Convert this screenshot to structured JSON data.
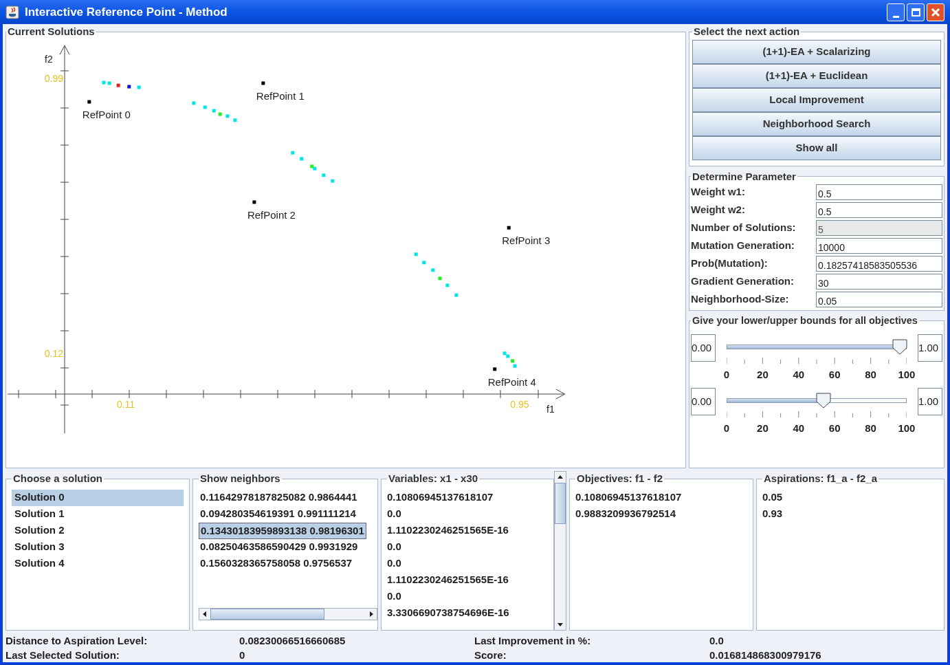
{
  "window": {
    "title": "Interactive Reference Point - Method"
  },
  "plot": {
    "title": "Current Solutions",
    "chart_data": {
      "type": "scatter",
      "xlabel": "f1",
      "ylabel": "f2",
      "xlim": [
        -0.142,
        1.045
      ],
      "ylim": [
        -0.133,
        1.093
      ],
      "xticks": [
        {
          "value": 0.11,
          "label": "0.11"
        },
        {
          "value": 0.95,
          "label": "0.95"
        }
      ],
      "yticks": [
        {
          "value": 0.99,
          "label": "0.99"
        },
        {
          "value": 0.12,
          "label": "0.12"
        }
      ],
      "series": [
        {
          "color": "#00e5e5",
          "x": [
            0.063,
            0.075,
            0.138,
            0.255,
            0.279,
            0.298,
            0.327,
            0.343,
            0.466,
            0.485,
            0.513,
            0.532,
            0.551,
            0.729,
            0.746,
            0.765,
            0.796,
            0.815,
            0.918,
            0.925,
            0.94
          ],
          "values": [
            0.976,
            0.974,
            0.961,
            0.911,
            0.898,
            0.887,
            0.87,
            0.857,
            0.754,
            0.735,
            0.704,
            0.683,
            0.665,
            0.433,
            0.407,
            0.383,
            0.335,
            0.304,
            0.12,
            0.111,
            0.08
          ]
        },
        {
          "color": "#22ee22",
          "x": [
            0.311,
            0.507,
            0.78,
            0.935
          ],
          "values": [
            0.876,
            0.711,
            0.357,
            0.096
          ]
        },
        {
          "color": "#e02020",
          "x": [
            0.094
          ],
          "values": [
            0.967
          ]
        },
        {
          "color": "#1010d0",
          "x": [
            0.117
          ],
          "values": [
            0.963
          ]
        },
        {
          "color": "#000000",
          "x": [
            0.032,
            0.403,
            0.384,
            0.927,
            0.897
          ],
          "values": [
            0.915,
            0.974,
            0.598,
            0.517,
            0.07
          ]
        }
      ],
      "annotations": [
        {
          "text": "RefPoint 0",
          "x": 0.032,
          "y": 0.915
        },
        {
          "text": "RefPoint 1",
          "x": 0.403,
          "y": 0.974
        },
        {
          "text": "RefPoint 2",
          "x": 0.384,
          "y": 0.598
        },
        {
          "text": "RefPoint 3",
          "x": 0.927,
          "y": 0.517
        },
        {
          "text": "RefPoint 4",
          "x": 0.897,
          "y": 0.07
        }
      ]
    }
  },
  "actions": {
    "title": "Select the next action",
    "buttons": [
      "(1+1)-EA + Scalarizing",
      "(1+1)-EA + Euclidean",
      "Local Improvement",
      "Neighborhood Search",
      "Show all"
    ]
  },
  "parameters": {
    "title": "Determine Parameter",
    "fields": [
      {
        "label": "Weight w1:",
        "value": "0.5",
        "disabled": false
      },
      {
        "label": "Weight w2:",
        "value": "0.5",
        "disabled": false
      },
      {
        "label": "Number of Solutions:",
        "value": "5",
        "disabled": true
      },
      {
        "label": "Mutation Generation:",
        "value": "10000",
        "disabled": false
      },
      {
        "label": "Prob(Mutation):",
        "value": "0.18257418583505536",
        "disabled": false
      },
      {
        "label": "Gradient Generation:",
        "value": "30",
        "disabled": false
      },
      {
        "label": "Neighborhood-Size:",
        "value": "0.05",
        "disabled": false
      }
    ]
  },
  "bounds": {
    "title": "Give your lower/upper bounds for all objectives",
    "sliders": [
      {
        "lower": "0.00",
        "upper": "1.00",
        "level": 0.96,
        "scale": [
          "0",
          "20",
          "40",
          "60",
          "80",
          "100"
        ]
      },
      {
        "lower": "0.00",
        "upper": "1.00",
        "level": 0.54,
        "scale": [
          "0",
          "20",
          "40",
          "60",
          "80",
          "100"
        ]
      }
    ]
  },
  "solutions": {
    "title": "Choose a solution",
    "items": [
      {
        "label": "Solution 0",
        "selected": true
      },
      {
        "label": "Solution 1",
        "selected": false
      },
      {
        "label": "Solution 2",
        "selected": false
      },
      {
        "label": "Solution 3",
        "selected": false
      },
      {
        "label": "Solution 4",
        "selected": false
      }
    ]
  },
  "neighbors": {
    "title": "Show neighbors",
    "items": [
      {
        "label": "0.11642978187825082 0.9864441",
        "selected": false
      },
      {
        "label": "0.094280354619391 0.991111214",
        "selected": false
      },
      {
        "label": "0.13430183959893138 0.98196301",
        "selected": true
      },
      {
        "label": "0.08250463586590429 0.9931929",
        "selected": false
      },
      {
        "label": "0.1560328365758058 0.9756537",
        "selected": false
      }
    ]
  },
  "variables": {
    "title": "Variables: x1 - x30",
    "values": [
      "0.10806945137618107",
      "0.0",
      "1.1102230246251565E-16",
      "0.0",
      "0.0",
      "1.1102230246251565E-16",
      "0.0",
      "3.3306690738754696E-16"
    ]
  },
  "objectives": {
    "title": "Objectives: f1 - f2",
    "values": [
      "0.10806945137618107",
      "0.9883209936792514"
    ]
  },
  "aspirations": {
    "title": "Aspirations: f1_a - f2_a",
    "values": [
      "0.05",
      "0.93"
    ]
  },
  "status": [
    {
      "label": "Distance to Aspiration Level:",
      "value": "0.08230066516660685"
    },
    {
      "label": "Last Improvement in %:",
      "value": "0.0"
    },
    {
      "label": "Last Selected Solution:",
      "value": "0"
    },
    {
      "label": "Score:",
      "value": "0.016814868300979176"
    }
  ]
}
